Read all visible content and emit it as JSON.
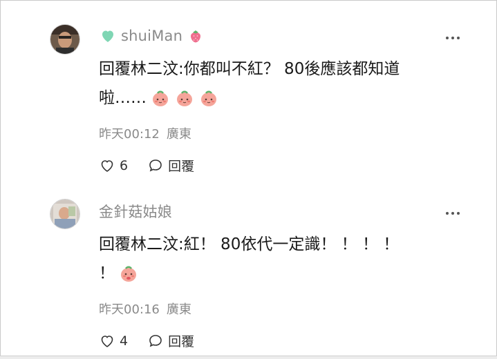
{
  "comments": [
    {
      "username": "shuiMan",
      "line1": "回覆林二汶:你都叫不紅？ 80後應該都知道",
      "line2": "啦……",
      "emoji_count": 3,
      "time": "昨天00:12",
      "location": "廣東",
      "likes": "6",
      "reply_label": "回覆"
    },
    {
      "username": "金針菇姑娘",
      "line1": "回覆林二汶:紅！ 80依代一定識！ ！ ！ ！",
      "line2": "！",
      "emoji_count": 1,
      "time": "昨天00:16",
      "location": "廣東",
      "likes": "4",
      "reply_label": "回覆"
    }
  ],
  "colors": {
    "meta": "#8a8a8a",
    "heart_badge": "#7fd6b4",
    "strawberry": "#ef6f8e"
  },
  "icons": [
    "avatar",
    "heart-badge-icon",
    "strawberry-badge-icon",
    "peach-emoji-icon",
    "heart-outline-icon",
    "speech-bubble-icon",
    "more-icon"
  ]
}
